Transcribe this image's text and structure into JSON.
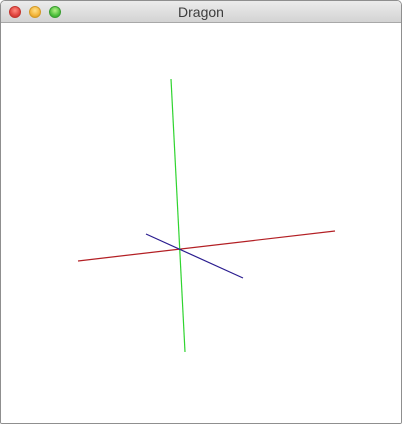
{
  "window": {
    "title": "Dragon"
  },
  "scene": {
    "axes": [
      {
        "name": "x-axis",
        "color": "#b31f24"
      },
      {
        "name": "y-axis",
        "color": "#2fd42f"
      },
      {
        "name": "z-axis",
        "color": "#2a1c8f"
      }
    ],
    "background": "#ffffff"
  }
}
